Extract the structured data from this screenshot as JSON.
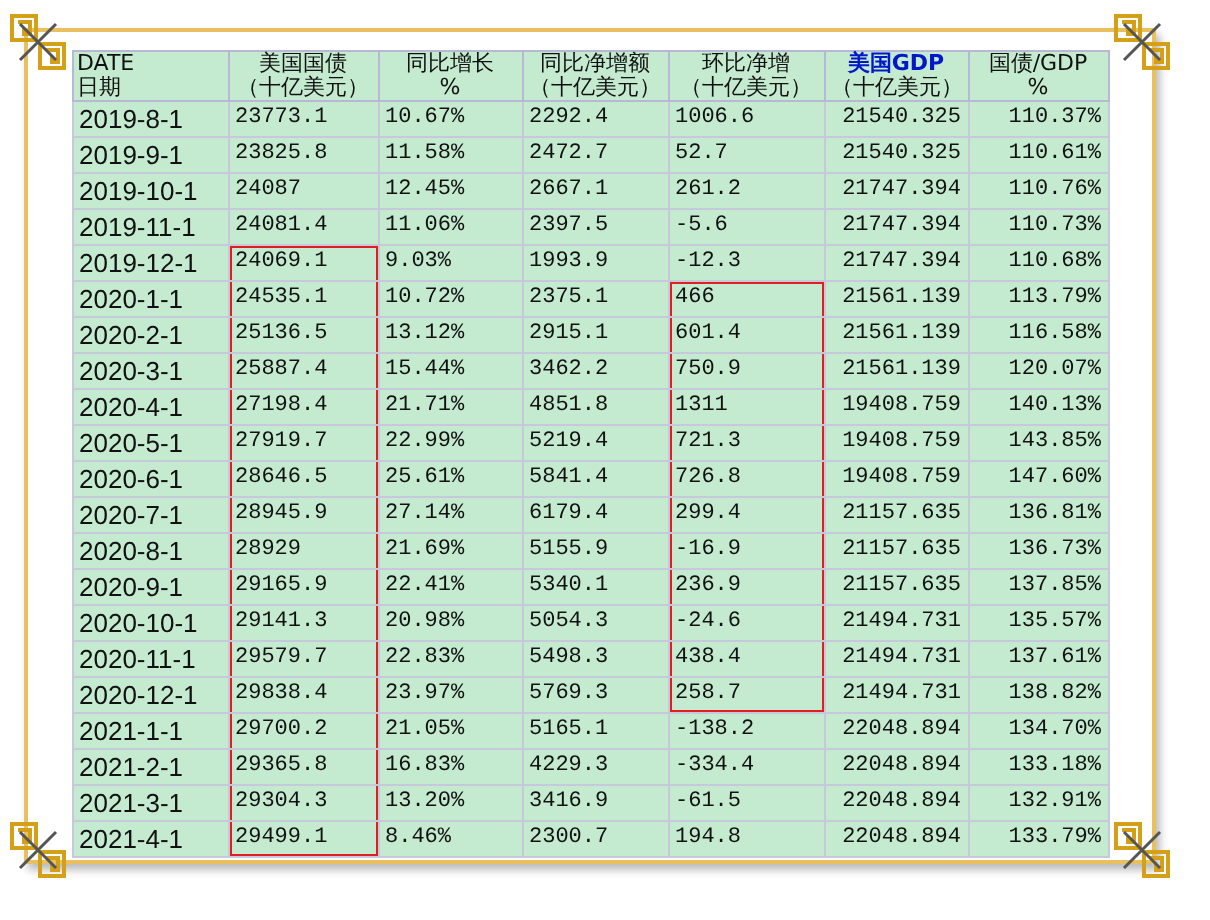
{
  "table": {
    "columns": [
      {
        "lines": [
          "DATE",
          "日期"
        ],
        "highlighted": false
      },
      {
        "lines": [
          "美国国债",
          "（十亿美元）"
        ],
        "highlighted": false
      },
      {
        "lines": [
          "同比增长",
          "%"
        ],
        "highlighted": false
      },
      {
        "lines": [
          "同比净增额",
          "（十亿美元）"
        ],
        "highlighted": false
      },
      {
        "lines": [
          "环比净增",
          "（十亿美元）"
        ],
        "highlighted": false
      },
      {
        "lines": [
          "美国GDP",
          "（十亿美元）"
        ],
        "highlighted": true
      },
      {
        "lines": [
          "国债/GDP",
          "%"
        ],
        "highlighted": false
      }
    ],
    "rows": [
      {
        "cells": [
          "2019-8-1",
          "23773.1",
          "10.67%",
          "2292.4",
          "1006.6",
          "21540.325",
          "110.37%"
        ],
        "boxed_debt": false,
        "boxed_mom": false
      },
      {
        "cells": [
          "2019-9-1",
          "23825.8",
          "11.58%",
          "2472.7",
          "52.7",
          "21540.325",
          "110.61%"
        ],
        "boxed_debt": false,
        "boxed_mom": false
      },
      {
        "cells": [
          "2019-10-1",
          "24087",
          "12.45%",
          "2667.1",
          "261.2",
          "21747.394",
          "110.76%"
        ],
        "boxed_debt": false,
        "boxed_mom": false
      },
      {
        "cells": [
          "2019-11-1",
          "24081.4",
          "11.06%",
          "2397.5",
          "-5.6",
          "21747.394",
          "110.73%"
        ],
        "boxed_debt": false,
        "boxed_mom": false
      },
      {
        "cells": [
          "2019-12-1",
          "24069.1",
          "9.03%",
          "1993.9",
          "-12.3",
          "21747.394",
          "110.68%"
        ],
        "boxed_debt": true,
        "boxed_mom": false
      },
      {
        "cells": [
          "2020-1-1",
          "24535.1",
          "10.72%",
          "2375.1",
          "466",
          "21561.139",
          "113.79%"
        ],
        "boxed_debt": true,
        "boxed_mom": true
      },
      {
        "cells": [
          "2020-2-1",
          "25136.5",
          "13.12%",
          "2915.1",
          "601.4",
          "21561.139",
          "116.58%"
        ],
        "boxed_debt": true,
        "boxed_mom": true
      },
      {
        "cells": [
          "2020-3-1",
          "25887.4",
          "15.44%",
          "3462.2",
          "750.9",
          "21561.139",
          "120.07%"
        ],
        "boxed_debt": true,
        "boxed_mom": true
      },
      {
        "cells": [
          "2020-4-1",
          "27198.4",
          "21.71%",
          "4851.8",
          "1311",
          "19408.759",
          "140.13%"
        ],
        "boxed_debt": true,
        "boxed_mom": true
      },
      {
        "cells": [
          "2020-5-1",
          "27919.7",
          "22.99%",
          "5219.4",
          "721.3",
          "19408.759",
          "143.85%"
        ],
        "boxed_debt": true,
        "boxed_mom": true
      },
      {
        "cells": [
          "2020-6-1",
          "28646.5",
          "25.61%",
          "5841.4",
          "726.8",
          "19408.759",
          "147.60%"
        ],
        "boxed_debt": true,
        "boxed_mom": true
      },
      {
        "cells": [
          "2020-7-1",
          "28945.9",
          "27.14%",
          "6179.4",
          "299.4",
          "21157.635",
          "136.81%"
        ],
        "boxed_debt": true,
        "boxed_mom": true
      },
      {
        "cells": [
          "2020-8-1",
          "28929",
          "21.69%",
          "5155.9",
          "-16.9",
          "21157.635",
          "136.73%"
        ],
        "boxed_debt": true,
        "boxed_mom": true
      },
      {
        "cells": [
          "2020-9-1",
          "29165.9",
          "22.41%",
          "5340.1",
          "236.9",
          "21157.635",
          "137.85%"
        ],
        "boxed_debt": true,
        "boxed_mom": true
      },
      {
        "cells": [
          "2020-10-1",
          "29141.3",
          "20.98%",
          "5054.3",
          "-24.6",
          "21494.731",
          "135.57%"
        ],
        "boxed_debt": true,
        "boxed_mom": true
      },
      {
        "cells": [
          "2020-11-1",
          "29579.7",
          "22.83%",
          "5498.3",
          "438.4",
          "21494.731",
          "137.61%"
        ],
        "boxed_debt": true,
        "boxed_mom": true
      },
      {
        "cells": [
          "2020-12-1",
          "29838.4",
          "23.97%",
          "5769.3",
          "258.7",
          "21494.731",
          "138.82%"
        ],
        "boxed_debt": true,
        "boxed_mom": true
      },
      {
        "cells": [
          "2021-1-1",
          "29700.2",
          "21.05%",
          "5165.1",
          "-138.2",
          "22048.894",
          "134.70%"
        ],
        "boxed_debt": true,
        "boxed_mom": false
      },
      {
        "cells": [
          "2021-2-1",
          "29365.8",
          "16.83%",
          "4229.3",
          "-334.4",
          "22048.894",
          "133.18%"
        ],
        "boxed_debt": true,
        "boxed_mom": false
      },
      {
        "cells": [
          "2021-3-1",
          "29304.3",
          "13.20%",
          "3416.9",
          "-61.5",
          "22048.894",
          "132.91%"
        ],
        "boxed_debt": true,
        "boxed_mom": false
      },
      {
        "cells": [
          "2021-4-1",
          "29499.1",
          "8.46%",
          "2300.7",
          "194.8",
          "22048.894",
          "133.79%"
        ],
        "boxed_debt": true,
        "boxed_mom": false
      }
    ]
  }
}
